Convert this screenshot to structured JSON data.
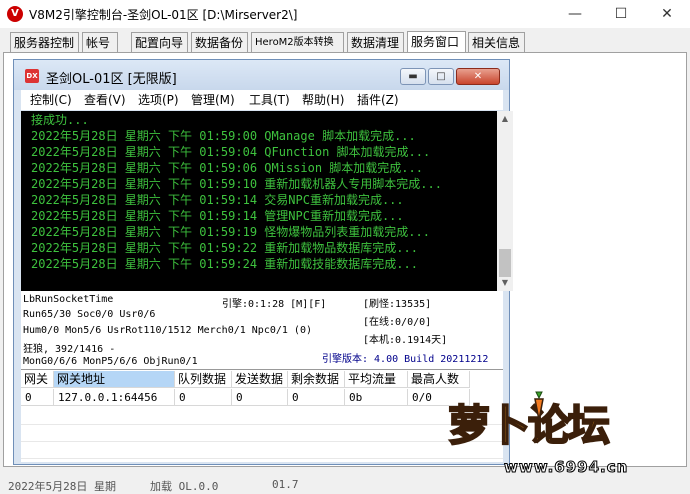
{
  "app": {
    "title": "V8M2引擎控制台-圣剑OL-01区 [D:\\Mirserver2\\]"
  },
  "tabs": [
    {
      "label": "服务器控制"
    },
    {
      "label": "帐号"
    },
    {
      "label": "配置向导"
    },
    {
      "label": "数据备份"
    },
    {
      "label": "HeroM2版本转换"
    },
    {
      "label": "数据清理"
    },
    {
      "label": "服务窗口"
    },
    {
      "label": "相关信息"
    }
  ],
  "window": {
    "title": "圣剑OL-01区 [无限版]",
    "menu": [
      "控制(C)",
      "查看(V)",
      "选项(P)",
      "管理(M)",
      "工具(T)",
      "帮助(H)",
      "插件(Z)"
    ]
  },
  "log": [
    "接成功...",
    "2022年5月28日 星期六 下午 01:59:00 QManage 脚本加载完成...",
    "2022年5月28日 星期六 下午 01:59:04 QFunction 脚本加载完成...",
    "2022年5月28日 星期六 下午 01:59:06 QMission 脚本加载完成...",
    "2022年5月28日 星期六 下午 01:59:10 重新加载机器人专用脚本完成...",
    "2022年5月28日 星期六 下午 01:59:14 交易NPC重新加载完成...",
    "2022年5月28日 星期六 下午 01:59:14 管理NPC重新加载完成...",
    "2022年5月28日 星期六 下午 01:59:19 怪物爆物品列表重加载完成...",
    "2022年5月28日 星期六 下午 01:59:22 重新加载物品数据库完成...",
    "2022年5月28日 星期六 下午 01:59:24 重新加载技能数据库完成..."
  ],
  "status": {
    "socket": "LbRunSocketTime",
    "engine_time": "引擎:0:1:28 [M][F]",
    "refresh": "[刷怪:13535]",
    "run": "Run65/30 Soc0/0 Usr0/6",
    "online": "[在线:0/0/0]",
    "hum": "Hum0/0 Mon5/6 UsrRot110/1512 Merch0/1 Npc0/1 (0)",
    "machine": "[本机:0.1914天]",
    "wolf": "狂狼, 392/1416 -",
    "mongo": "MonG0/6/6 MonP5/6/6 ObjRun0/1",
    "engine_version": "引擎版本: 4.00 Build 20211212"
  },
  "gate_table": {
    "headers": [
      "网关",
      "网关地址",
      "队列数据",
      "发送数据",
      "剩余数据",
      "平均流量",
      "最高人数"
    ],
    "rows": [
      [
        "0",
        "127.0.0.1:64456",
        "0",
        "0",
        "0",
        "0b",
        "0/0"
      ]
    ]
  },
  "bottom_fragments": [
    "2022年5月28日 星期",
    "加载 OL.0.0",
    "01.7"
  ],
  "watermark": {
    "text": "萝卜论坛",
    "url": "www.6994.cn"
  }
}
